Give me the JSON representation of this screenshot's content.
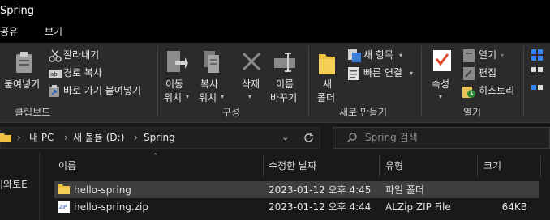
{
  "window": {
    "title": "Spring"
  },
  "ribbon_tabs": [
    {
      "label": "공유"
    },
    {
      "label": "보기"
    }
  ],
  "clipboard": {
    "paste_label": "붙여넣기",
    "cut_label": "잘라내기",
    "copy_path_label": "경로 복사",
    "paste_shortcut_label": "바로 가기 붙여넣기",
    "group_label": "클립보드"
  },
  "organize": {
    "move_to_line1": "이동",
    "move_to_line2": "위치",
    "copy_to_line1": "복사",
    "copy_to_line2": "위치",
    "delete_label": "삭제",
    "rename_line1": "이름",
    "rename_line2": "바꾸기",
    "group_label": "구성"
  },
  "new": {
    "new_folder_line1": "새",
    "new_folder_line2": "폴더",
    "new_item_label": "새 항목",
    "easy_access_label": "빠른 연결",
    "group_label": "새로 만들기"
  },
  "open": {
    "properties_label": "속성",
    "open_label": "열기",
    "edit_label": "편집",
    "history_label": "히스토리",
    "group_label": "열기"
  },
  "address": {
    "crumbs": [
      {
        "label": "내 PC"
      },
      {
        "label": "새 볼륨 (D:)"
      },
      {
        "label": "Spring"
      }
    ]
  },
  "search": {
    "placeholder": "Spring 검색"
  },
  "nav": {
    "partial_item": "|와토E"
  },
  "columns": [
    {
      "label": "이름"
    },
    {
      "label": "수정한 날짜"
    },
    {
      "label": "유형"
    },
    {
      "label": "크기"
    }
  ],
  "files": [
    {
      "name": "hello-spring",
      "modified": "2023-01-12 오후 4:45",
      "type": "파일 폴더",
      "size": "",
      "icon": "folder-icon",
      "selected": true
    },
    {
      "name": "hello-spring.zip",
      "modified": "2023-01-12 오후 4:44",
      "type": "ALZip ZIP File",
      "size": "64KB",
      "icon": "zip-file-icon",
      "selected": false
    }
  ],
  "colors": {
    "selection": "#3e3e3e",
    "folder": "#f4c542",
    "accent": "#0a84ff"
  }
}
